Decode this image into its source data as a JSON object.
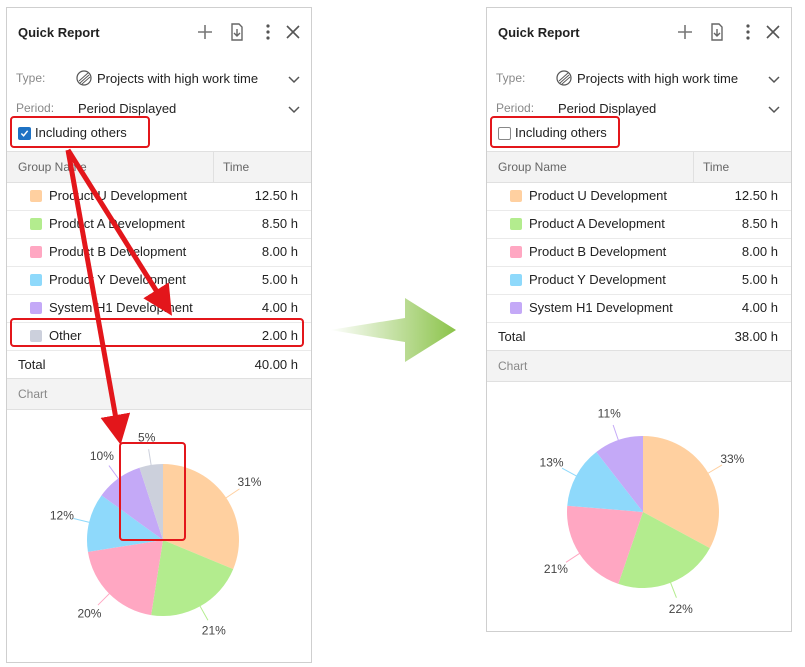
{
  "colors": {
    "accent": "#1e72c4",
    "highlight": "#e3161b",
    "arrow": "#8bc34a"
  },
  "before": {
    "title": "Quick Report",
    "type_label": "Type:",
    "type_value": "Projects with high work time",
    "period_label": "Period:",
    "period_value": "Period Displayed",
    "checkbox_label": "Including others",
    "checkbox_checked": true,
    "columns": [
      "Group Name",
      "Time"
    ],
    "rows": [
      {
        "name": "Product U Development",
        "time": "12.50 h",
        "color": "#ffd0a0"
      },
      {
        "name": "Product A Development",
        "time": "8.50 h",
        "color": "#b3ec8e"
      },
      {
        "name": "Product B Development",
        "time": "8.00 h",
        "color": "#ffa7c2"
      },
      {
        "name": "Product Y Development",
        "time": "5.00 h",
        "color": "#8ed9fb"
      },
      {
        "name": "System H1 Development",
        "time": "4.00 h",
        "color": "#c4a9f7"
      },
      {
        "name": "Other",
        "time": "2.00 h",
        "color": "#ccd0dc"
      }
    ],
    "total_label": "Total",
    "total_value": "40.00 h",
    "chart_label": "Chart"
  },
  "after": {
    "title": "Quick Report",
    "type_label": "Type:",
    "type_value": "Projects with high work time",
    "period_label": "Period:",
    "period_value": "Period Displayed",
    "checkbox_label": "Including others",
    "checkbox_checked": false,
    "columns": [
      "Group Name",
      "Time"
    ],
    "rows": [
      {
        "name": "Product U Development",
        "time": "12.50 h",
        "color": "#ffd0a0"
      },
      {
        "name": "Product A Development",
        "time": "8.50 h",
        "color": "#b3ec8e"
      },
      {
        "name": "Product B Development",
        "time": "8.00 h",
        "color": "#ffa7c2"
      },
      {
        "name": "Product Y Development",
        "time": "5.00 h",
        "color": "#8ed9fb"
      },
      {
        "name": "System H1 Development",
        "time": "4.00 h",
        "color": "#c4a9f7"
      }
    ],
    "total_label": "Total",
    "total_value": "38.00 h",
    "chart_label": "Chart"
  },
  "chart_data": [
    {
      "type": "pie",
      "categories": [
        "Product U Development",
        "Product A Development",
        "Product B Development",
        "Product Y Development",
        "System H1 Development",
        "Other"
      ],
      "values": [
        12.5,
        8.5,
        8.0,
        5.0,
        4.0,
        2.0
      ],
      "labels": [
        "31%",
        "21%",
        "20%",
        "12%",
        "10%",
        "5%"
      ],
      "colors": [
        "#ffd0a0",
        "#b3ec8e",
        "#ffa7c2",
        "#8ed9fb",
        "#c4a9f7",
        "#ccd0dc"
      ]
    },
    {
      "type": "pie",
      "categories": [
        "Product U Development",
        "Product A Development",
        "Product B Development",
        "Product Y Development",
        "System H1 Development"
      ],
      "values": [
        12.5,
        8.5,
        8.0,
        5.0,
        4.0
      ],
      "labels": [
        "33%",
        "22%",
        "21%",
        "13%",
        "11%"
      ],
      "colors": [
        "#ffd0a0",
        "#b3ec8e",
        "#ffa7c2",
        "#8ed9fb",
        "#c4a9f7"
      ]
    }
  ]
}
